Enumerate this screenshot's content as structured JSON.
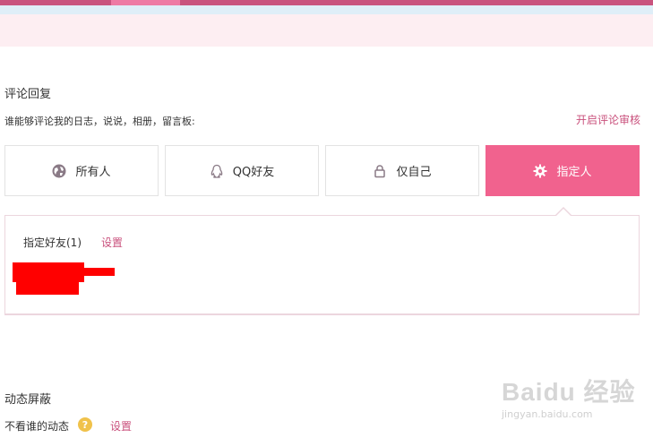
{
  "header": {},
  "comments": {
    "title": "评论回复",
    "question": "谁能够评论我的日志，说说，相册，留言板:",
    "review_link": "开启评论审核",
    "options": [
      {
        "label": "所有人",
        "icon": "globe-icon",
        "selected": false
      },
      {
        "label": "QQ好友",
        "icon": "qq-icon",
        "selected": false
      },
      {
        "label": "仅自己",
        "icon": "lock-icon",
        "selected": false
      },
      {
        "label": "指定人",
        "icon": "gear-icon",
        "selected": true
      }
    ],
    "panel": {
      "label": "指定好友(1)",
      "settings_link": "设置"
    }
  },
  "feed_block": {
    "title": "动态屏蔽",
    "label": "不看谁的动态",
    "help": "?",
    "settings_link": "设置"
  },
  "watermark": {
    "main": "Baidu 经验",
    "sub": "jingyan.baidu.com"
  },
  "colors": {
    "accent": "#f1628e",
    "link": "#c9507c",
    "topbar": "#c9537e"
  }
}
